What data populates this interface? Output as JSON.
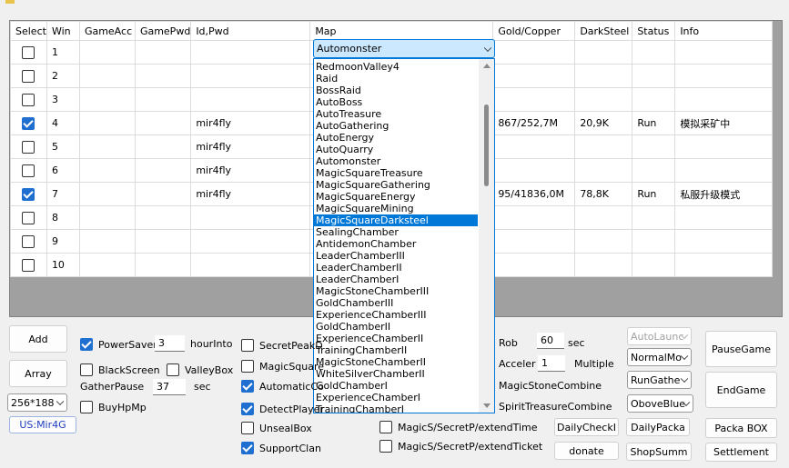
{
  "grid": {
    "headers": [
      "Select",
      "Win",
      "GameAcc",
      "GamePwd",
      "Id,Pwd",
      "Map",
      "Gold/Copper",
      "DarkSteel",
      "Status",
      "Info"
    ],
    "rows": [
      {
        "checked": false,
        "win": "1",
        "acc": "",
        "pwd": "",
        "id": "",
        "gold": "",
        "dark": "",
        "status": "",
        "info": ""
      },
      {
        "checked": false,
        "win": "2",
        "acc": "",
        "pwd": "",
        "id": "",
        "gold": "",
        "dark": "",
        "status": "",
        "info": ""
      },
      {
        "checked": false,
        "win": "3",
        "acc": "",
        "pwd": "",
        "id": "",
        "gold": "",
        "dark": "",
        "status": "",
        "info": ""
      },
      {
        "checked": true,
        "win": "4",
        "acc": "",
        "pwd": "",
        "id": "mir4fly",
        "gold": "867/252,7M",
        "dark": "20,9K",
        "status": "Run",
        "info": "模拟采矿中"
      },
      {
        "checked": false,
        "win": "5",
        "acc": "",
        "pwd": "",
        "id": "mir4fly",
        "gold": "",
        "dark": "",
        "status": "",
        "info": ""
      },
      {
        "checked": false,
        "win": "6",
        "acc": "",
        "pwd": "",
        "id": "mir4fly",
        "gold": "",
        "dark": "",
        "status": "",
        "info": ""
      },
      {
        "checked": true,
        "win": "7",
        "acc": "",
        "pwd": "",
        "id": "mir4fly",
        "gold": "95/41836,0M",
        "dark": "78,8K",
        "status": "Run",
        "info": "私服升级模式"
      },
      {
        "checked": false,
        "win": "8",
        "acc": "",
        "pwd": "",
        "id": "",
        "gold": "",
        "dark": "",
        "status": "",
        "info": ""
      },
      {
        "checked": false,
        "win": "9",
        "acc": "",
        "pwd": "",
        "id": "",
        "gold": "",
        "dark": "",
        "status": "",
        "info": ""
      },
      {
        "checked": false,
        "win": "10",
        "acc": "",
        "pwd": "",
        "id": "",
        "gold": "",
        "dark": "",
        "status": "",
        "info": ""
      }
    ]
  },
  "map_dropdown": {
    "value": "Automonster",
    "selected_index": 13,
    "options": [
      "RedmoonValley4",
      "Raid",
      "BossRaid",
      "AutoBoss",
      "AutoTreasure",
      "AutoGathering",
      "AutoEnergy",
      "AutoQuarry",
      "Automonster",
      "MagicSquareTreasure",
      "MagicSquareGathering",
      "MagicSquareEnergy",
      "MagicSquareMining",
      "MagicSquareDarksteel",
      "SealingChamber",
      "AntidemonChamber",
      "LeaderChamberIII",
      "LeaderChamberII",
      "LeaderChamberI",
      "MagicStoneChamberIII",
      "GoldChamberIII",
      "ExperienceChamberIII",
      "GoldChamberII",
      "ExperienceChamberII",
      "TrainingChamberII",
      "MagicStoneChamberII",
      "WhiteSilverChamberII",
      "GoldChamberI",
      "ExperienceChamberI",
      "TrainingChamberI"
    ]
  },
  "left": {
    "add": "Add",
    "array": "Array",
    "resolution": "256*188",
    "server": "US:Mir4G",
    "power_saver": "PowerSaver",
    "power_saver_value": "3",
    "hour_into": "hourInto",
    "black_screen": "BlackScreen",
    "valley_box": "ValleyBox",
    "gather_pause": "GatherPause",
    "gather_pause_value": "37",
    "sec": "sec",
    "buy_hp_mp": "BuyHpMp"
  },
  "middle": {
    "secret_peak": "SecretPeakD",
    "magic_square": "MagicSquare",
    "automatic": "AutomaticCo",
    "detect_player": "DetectPlayer",
    "unseal_box": "UnsealBox",
    "support_clan": "SupportClan",
    "extend_time": "MagicS/SecretP/extendTime",
    "extend_ticket": "MagicS/SecretP/extendTicket"
  },
  "right": {
    "rob": "Rob",
    "rob_value": "60",
    "rob_unit": "sec",
    "acceler": "Acceler",
    "acceler_value": "1",
    "multiple": "Multiple",
    "magic_stone_combine": "MagicStoneCombine",
    "spirit_treasure_combine": "SpiritTreasureCombine",
    "auto_launch": "AutoLaunc",
    "normal_mode": "NormalMo",
    "run_gather": "RunGathe",
    "obove_blue": "OboveBlue",
    "daily_check": "DailyCheckI",
    "daily_packa": "DailyPacka",
    "donate": "donate",
    "shop_summ": "ShopSumm",
    "pause_game": "PauseGame",
    "end_game": "EndGame",
    "packa_box": "Packa BOX",
    "settlement": "Settlement"
  }
}
